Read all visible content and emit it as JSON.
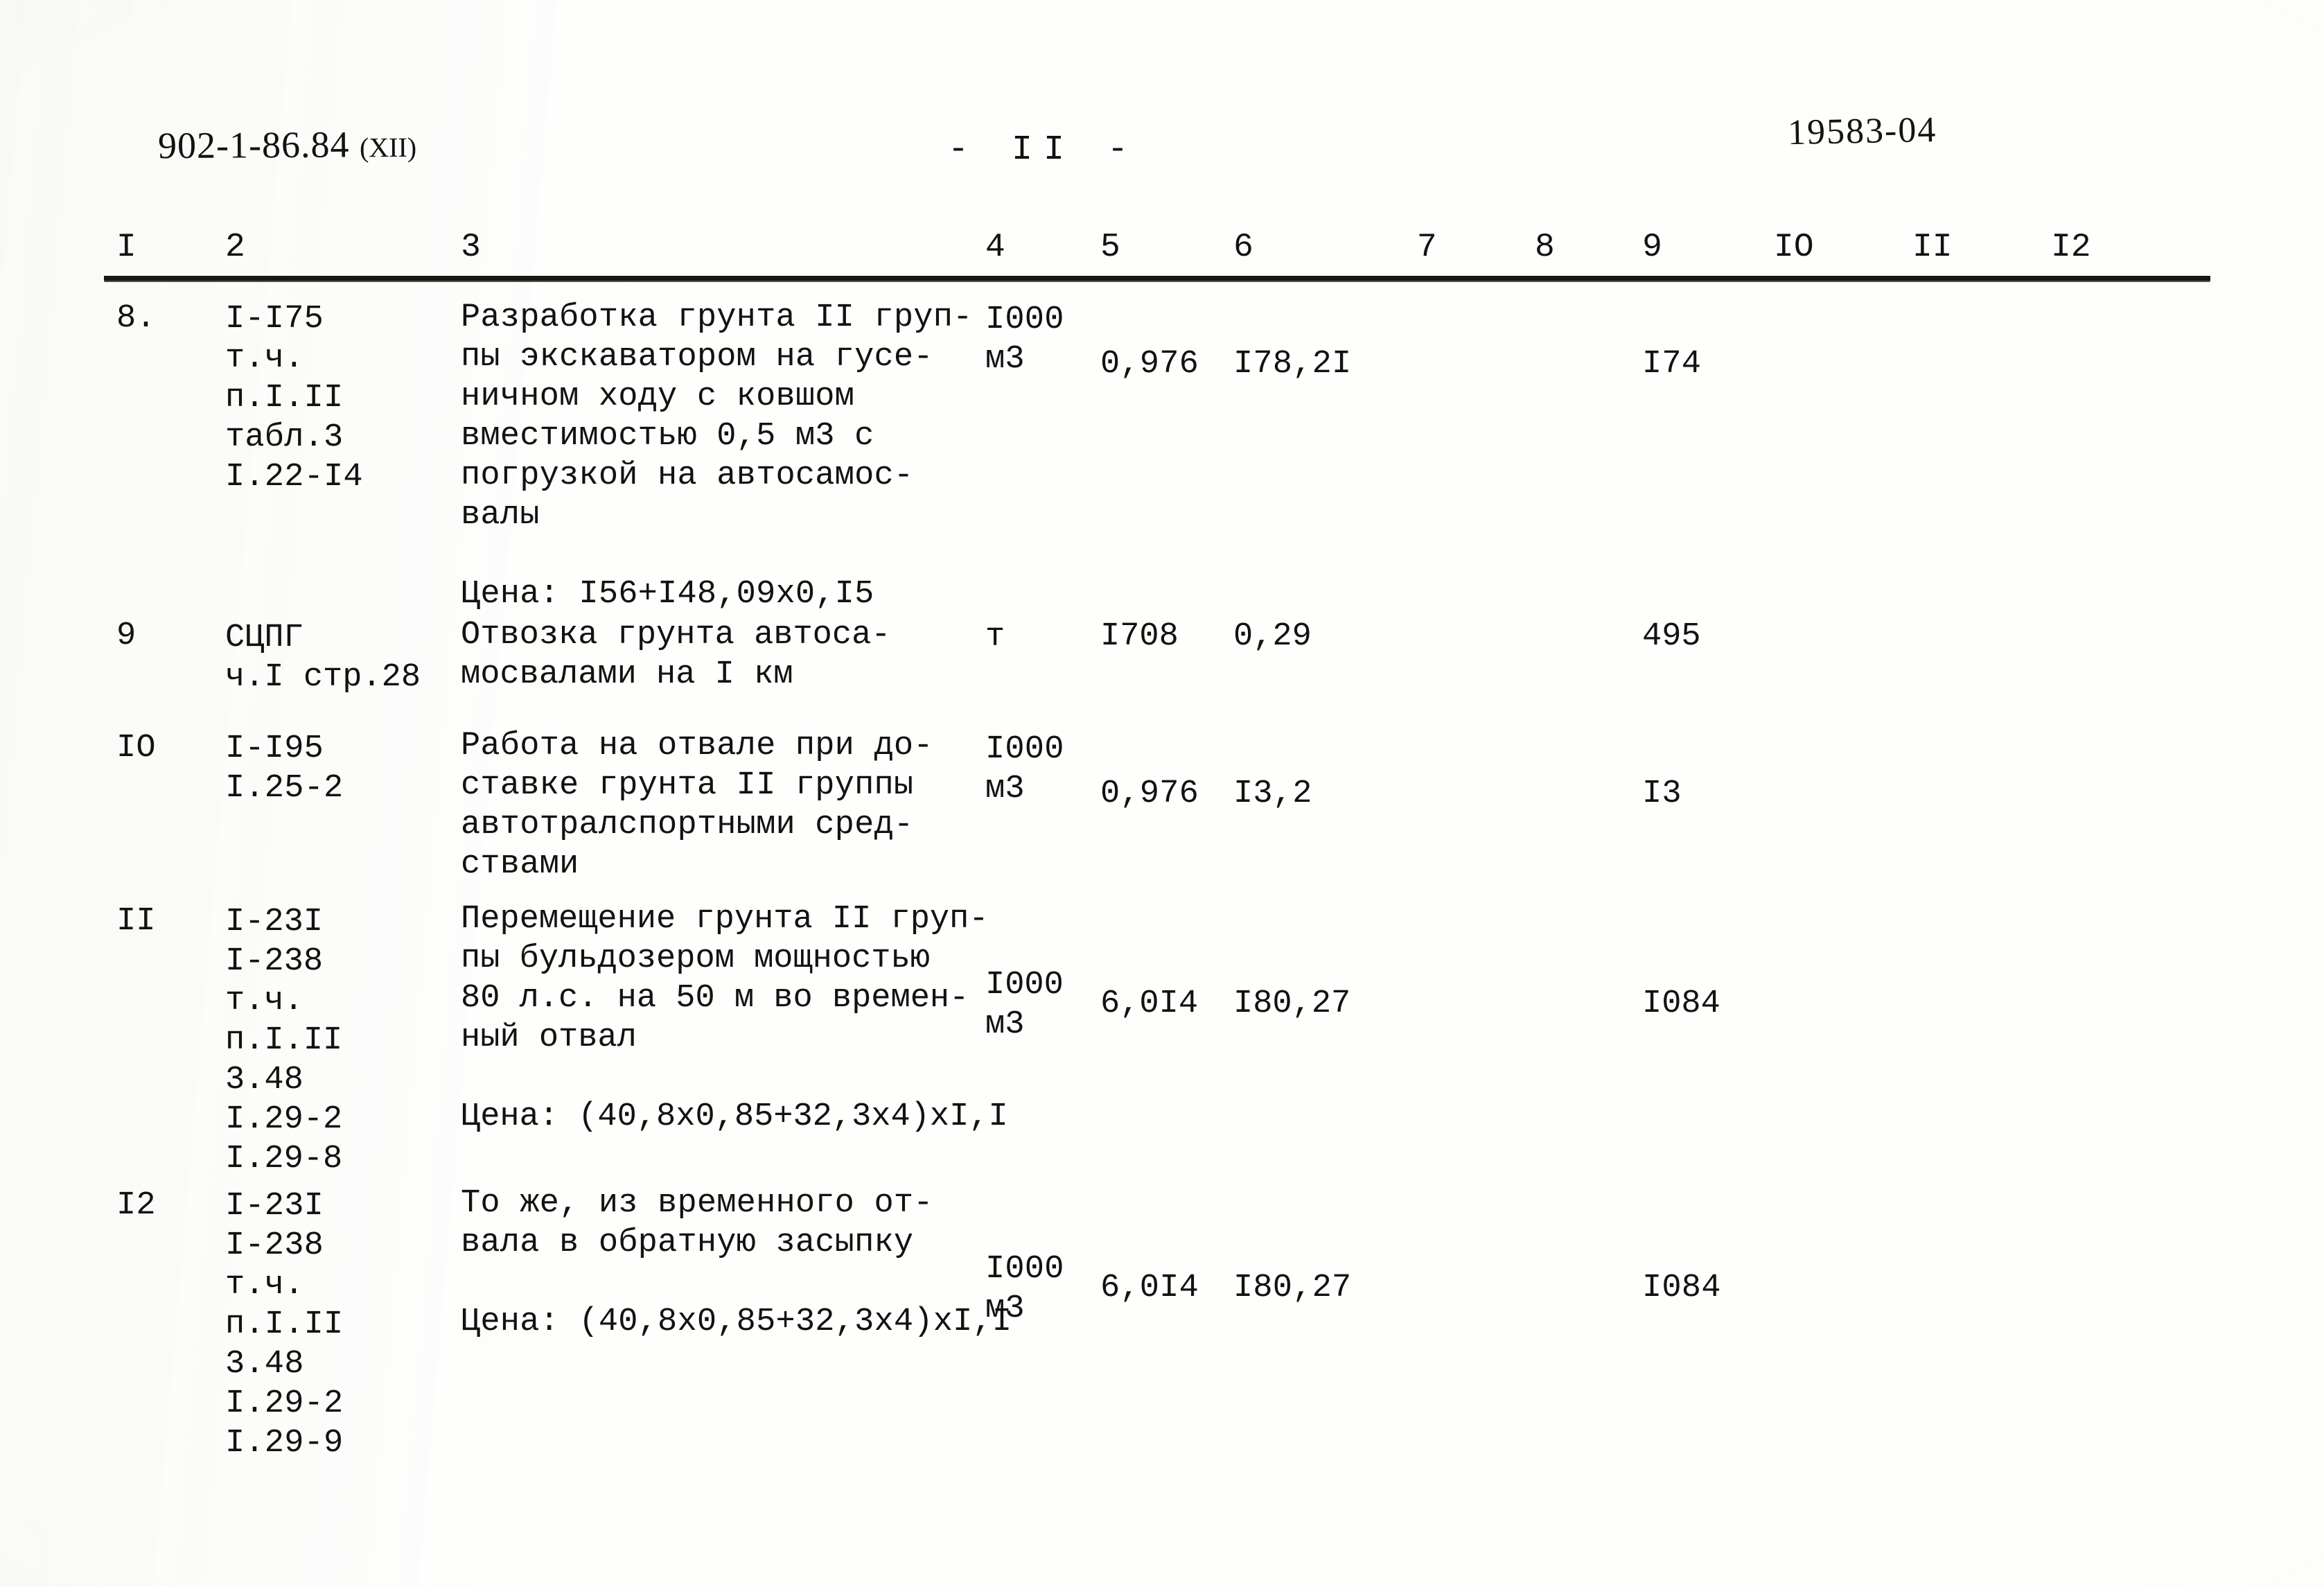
{
  "document": {
    "series_code": "902-1-86.84",
    "series_part": "(ХII)",
    "page_number": "-  II  -",
    "archive_number": "19583-04"
  },
  "table": {
    "column_numbers": [
      "I",
      "2",
      "3",
      "4",
      "5",
      "6",
      "7",
      "8",
      "9",
      "IO",
      "II",
      "I2"
    ],
    "rows": [
      {
        "num": "8.",
        "codes": [
          "I-I75",
          "т.ч.",
          "п.I.II",
          "табл.3",
          "I.22-I4"
        ],
        "desc_lines": [
          "Разработка грунта II груп-",
          "пы экскаватором на гусе-",
          "ничном ходу с ковшом",
          "вместимостью 0,5 м3 с",
          "погрузкой на автосамос-",
          "валы"
        ],
        "price_line": "Цена: I56+I48,09х0,I5",
        "unit_lines": [
          "I000",
          "м3"
        ],
        "col5": "0,976",
        "col6": "I78,2I",
        "col9": "I74"
      },
      {
        "num": "9",
        "codes": [
          "СЦПГ",
          "ч.I стр.28"
        ],
        "desc_lines": [
          "Отвозка грунта автоса-",
          "мосвалами на I км"
        ],
        "price_line": "",
        "unit_lines": [
          "т"
        ],
        "col5": "I708",
        "col6": "0,29",
        "col9": "495"
      },
      {
        "num": "IO",
        "codes": [
          "I-I95",
          "I.25-2"
        ],
        "desc_lines": [
          "Работа на отвале при до-",
          "ставке грунта II группы",
          "автотралспортными сред-",
          "ствами"
        ],
        "price_line": "",
        "unit_lines": [
          "I000",
          "м3"
        ],
        "col5": "0,976",
        "col6": "I3,2",
        "col9": "I3"
      },
      {
        "num": "II",
        "codes": [
          "I-23I",
          "I-238",
          "т.ч.",
          "п.I.II",
          "3.48",
          "I.29-2",
          "I.29-8"
        ],
        "desc_lines": [
          "Перемещение грунта II груп-",
          "пы бульдозером мощностью",
          "80 л.с. на 50 м во времен-",
          "ный отвал"
        ],
        "price_line": "Цена: (40,8х0,85+32,3х4)хI,I",
        "unit_lines": [
          "I000",
          "м3"
        ],
        "col5": "6,0I4",
        "col6": "I80,27",
        "col9": "I084"
      },
      {
        "num": "I2",
        "codes": [
          "I-23I",
          "I-238",
          "т.ч.",
          "п.I.II",
          "3.48",
          "I.29-2",
          "I.29-9"
        ],
        "desc_lines": [
          "То же, из временного от-",
          "вала в обратную засыпку"
        ],
        "price_line": "Цена: (40,8х0,85+32,3х4)хI,I",
        "unit_lines": [
          "I000",
          "м3"
        ],
        "col5": "6,0I4",
        "col6": "I80,27",
        "col9": "I084"
      }
    ]
  },
  "layout": {
    "column_number_x": [
      168,
      325,
      665,
      1422,
      1588,
      1780,
      2045,
      2215,
      2370,
      2560,
      2760,
      2960
    ],
    "row_tops": [
      430,
      890,
      1050,
      1300,
      1710
    ],
    "row_code_tops": [
      432,
      892,
      1052,
      1302,
      1712
    ],
    "row_desc_tops": [
      430,
      888,
      1048,
      1298,
      1708
    ],
    "row_unit_tops": [
      432,
      890,
      1052,
      1392,
      1802
    ],
    "row_num_tops": [
      432,
      890,
      1052,
      1302,
      1712
    ],
    "row_value_tops": [
      497,
      890,
      1117,
      1420,
      1830
    ],
    "price_offsets": [
      350,
      0,
      0,
      230,
      115
    ]
  },
  "colors": {
    "paper": "#fefefd",
    "ink": "#131210",
    "rule": "#181714"
  }
}
